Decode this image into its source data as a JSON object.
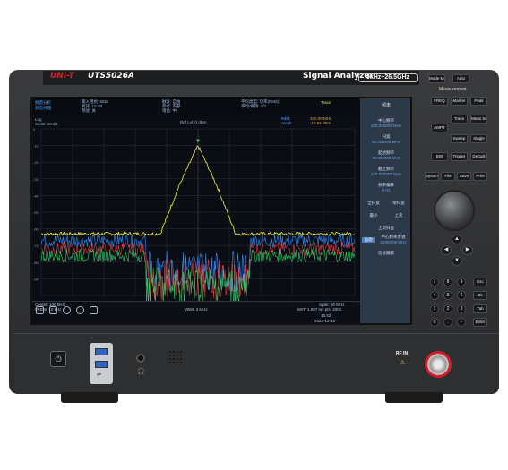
{
  "device": {
    "brand": "UNI-T",
    "model": "UTS5026A",
    "type_label": "Signal Analyzer",
    "freq_range": "9kHz~26.5GHz",
    "measurement_label": "Measurement",
    "rf_in_label": "RF IN"
  },
  "screen_header": {
    "mode": "频谱分析",
    "mode_sub": "频谱扫描",
    "input": "输入阻抗: 50Ω",
    "input2": "衰减: 10 dB",
    "input3": "预放: 关",
    "trig": "触发: 自由",
    "trig2": "参考: 内部",
    "trig3": "增益: 中",
    "avg": "平均类型: 功率(RMS)",
    "avg2": "平均/保持: 1/2",
    "trace_label": "Trace",
    "log": "Log",
    "scale": "Scale: 10 dB",
    "ref_level": "Ref Lvl: 0 dBm",
    "marker": "Mkr1",
    "marker_freq": "100.00 MHz",
    "marker_ampt": "Amplt",
    "marker_val": "-10.65 dBm"
  },
  "y_ticks": [
    "0",
    "-10",
    "-20",
    "-30",
    "-40",
    "-50",
    "-60",
    "-70",
    "-80",
    "-90"
  ],
  "footer": {
    "center": "Center: 100 MHz",
    "rbw": "#RBW: 10 kHz",
    "vbw": "VBW: 3 MHz",
    "span": "Span: 50 MHz",
    "swt": "SWT: 1.007 ms  pts: 4001",
    "time": "16:32",
    "date": "2023-12-15"
  },
  "panel": {
    "title": "频率",
    "items": [
      {
        "label": "中心频率",
        "value": "100.000000 MHz"
      },
      {
        "label": "扫宽",
        "value": "50.000000 MHz"
      },
      {
        "label": "起始频率",
        "value": "75.000000 MHz"
      },
      {
        "label": "截止频率",
        "value": "125.000000 MHz"
      },
      {
        "label": "频率偏移",
        "value": "0 Hz"
      }
    ],
    "row1": [
      "全扫宽",
      "零扫宽"
    ],
    "row2": [
      "最小",
      "上次"
    ],
    "next_label": "上次扫宽",
    "auto_btn": "自动",
    "step_label": "中心频率步进",
    "step_value": "5.000000 MHz",
    "signal_track": "信号跟踪"
  },
  "top_keys": {
    "mode": "Mode Mode",
    "auto": "Auto"
  },
  "meas_keys": [
    "FREQ",
    "Marker",
    "Peak",
    "Trace",
    "Meas Setup",
    "AMPT",
    "Sweep",
    "Single",
    "BW",
    "Trigger",
    "Default",
    "System",
    "File",
    "Save",
    "Print"
  ],
  "num_keys": [
    "7",
    "8",
    "9",
    "4",
    "5",
    "6",
    "1",
    "2",
    "3",
    "0",
    ".",
    "-"
  ],
  "side_keys": [
    "Esc",
    "Bk",
    "Tab",
    "Enter"
  ],
  "chart_data": {
    "type": "line",
    "xlabel": "",
    "ylabel": "",
    "xlim": [
      75,
      125
    ],
    "ylim": [
      -100,
      0
    ],
    "series": [
      {
        "color": "#f2f23a",
        "x": [
          75,
          88,
          94,
          97,
          100,
          103,
          106,
          112,
          125
        ],
        "y": [
          -63,
          -63,
          -63,
          -34,
          -10,
          -34,
          -63,
          -63,
          -63
        ]
      },
      {
        "color": "#2f8dff",
        "x": [
          75,
          91.5,
          92,
          108,
          108.5,
          125
        ],
        "y": [
          -67,
          -67,
          -68,
          -68,
          -67,
          -67
        ]
      },
      {
        "color": "#e33b3b",
        "x": [
          75,
          91.5,
          92,
          108,
          108.5,
          125
        ],
        "y": [
          -72,
          -72,
          -73,
          -73,
          -72,
          -72
        ]
      },
      {
        "color": "#2fd16a",
        "x": [
          75,
          91.5,
          92,
          108,
          108.5,
          125
        ],
        "y": [
          -76,
          -76,
          -77,
          -77,
          -76,
          -76
        ]
      }
    ],
    "peak_marker": {
      "x": 100,
      "y": -10,
      "color": "#3adf6a"
    }
  }
}
